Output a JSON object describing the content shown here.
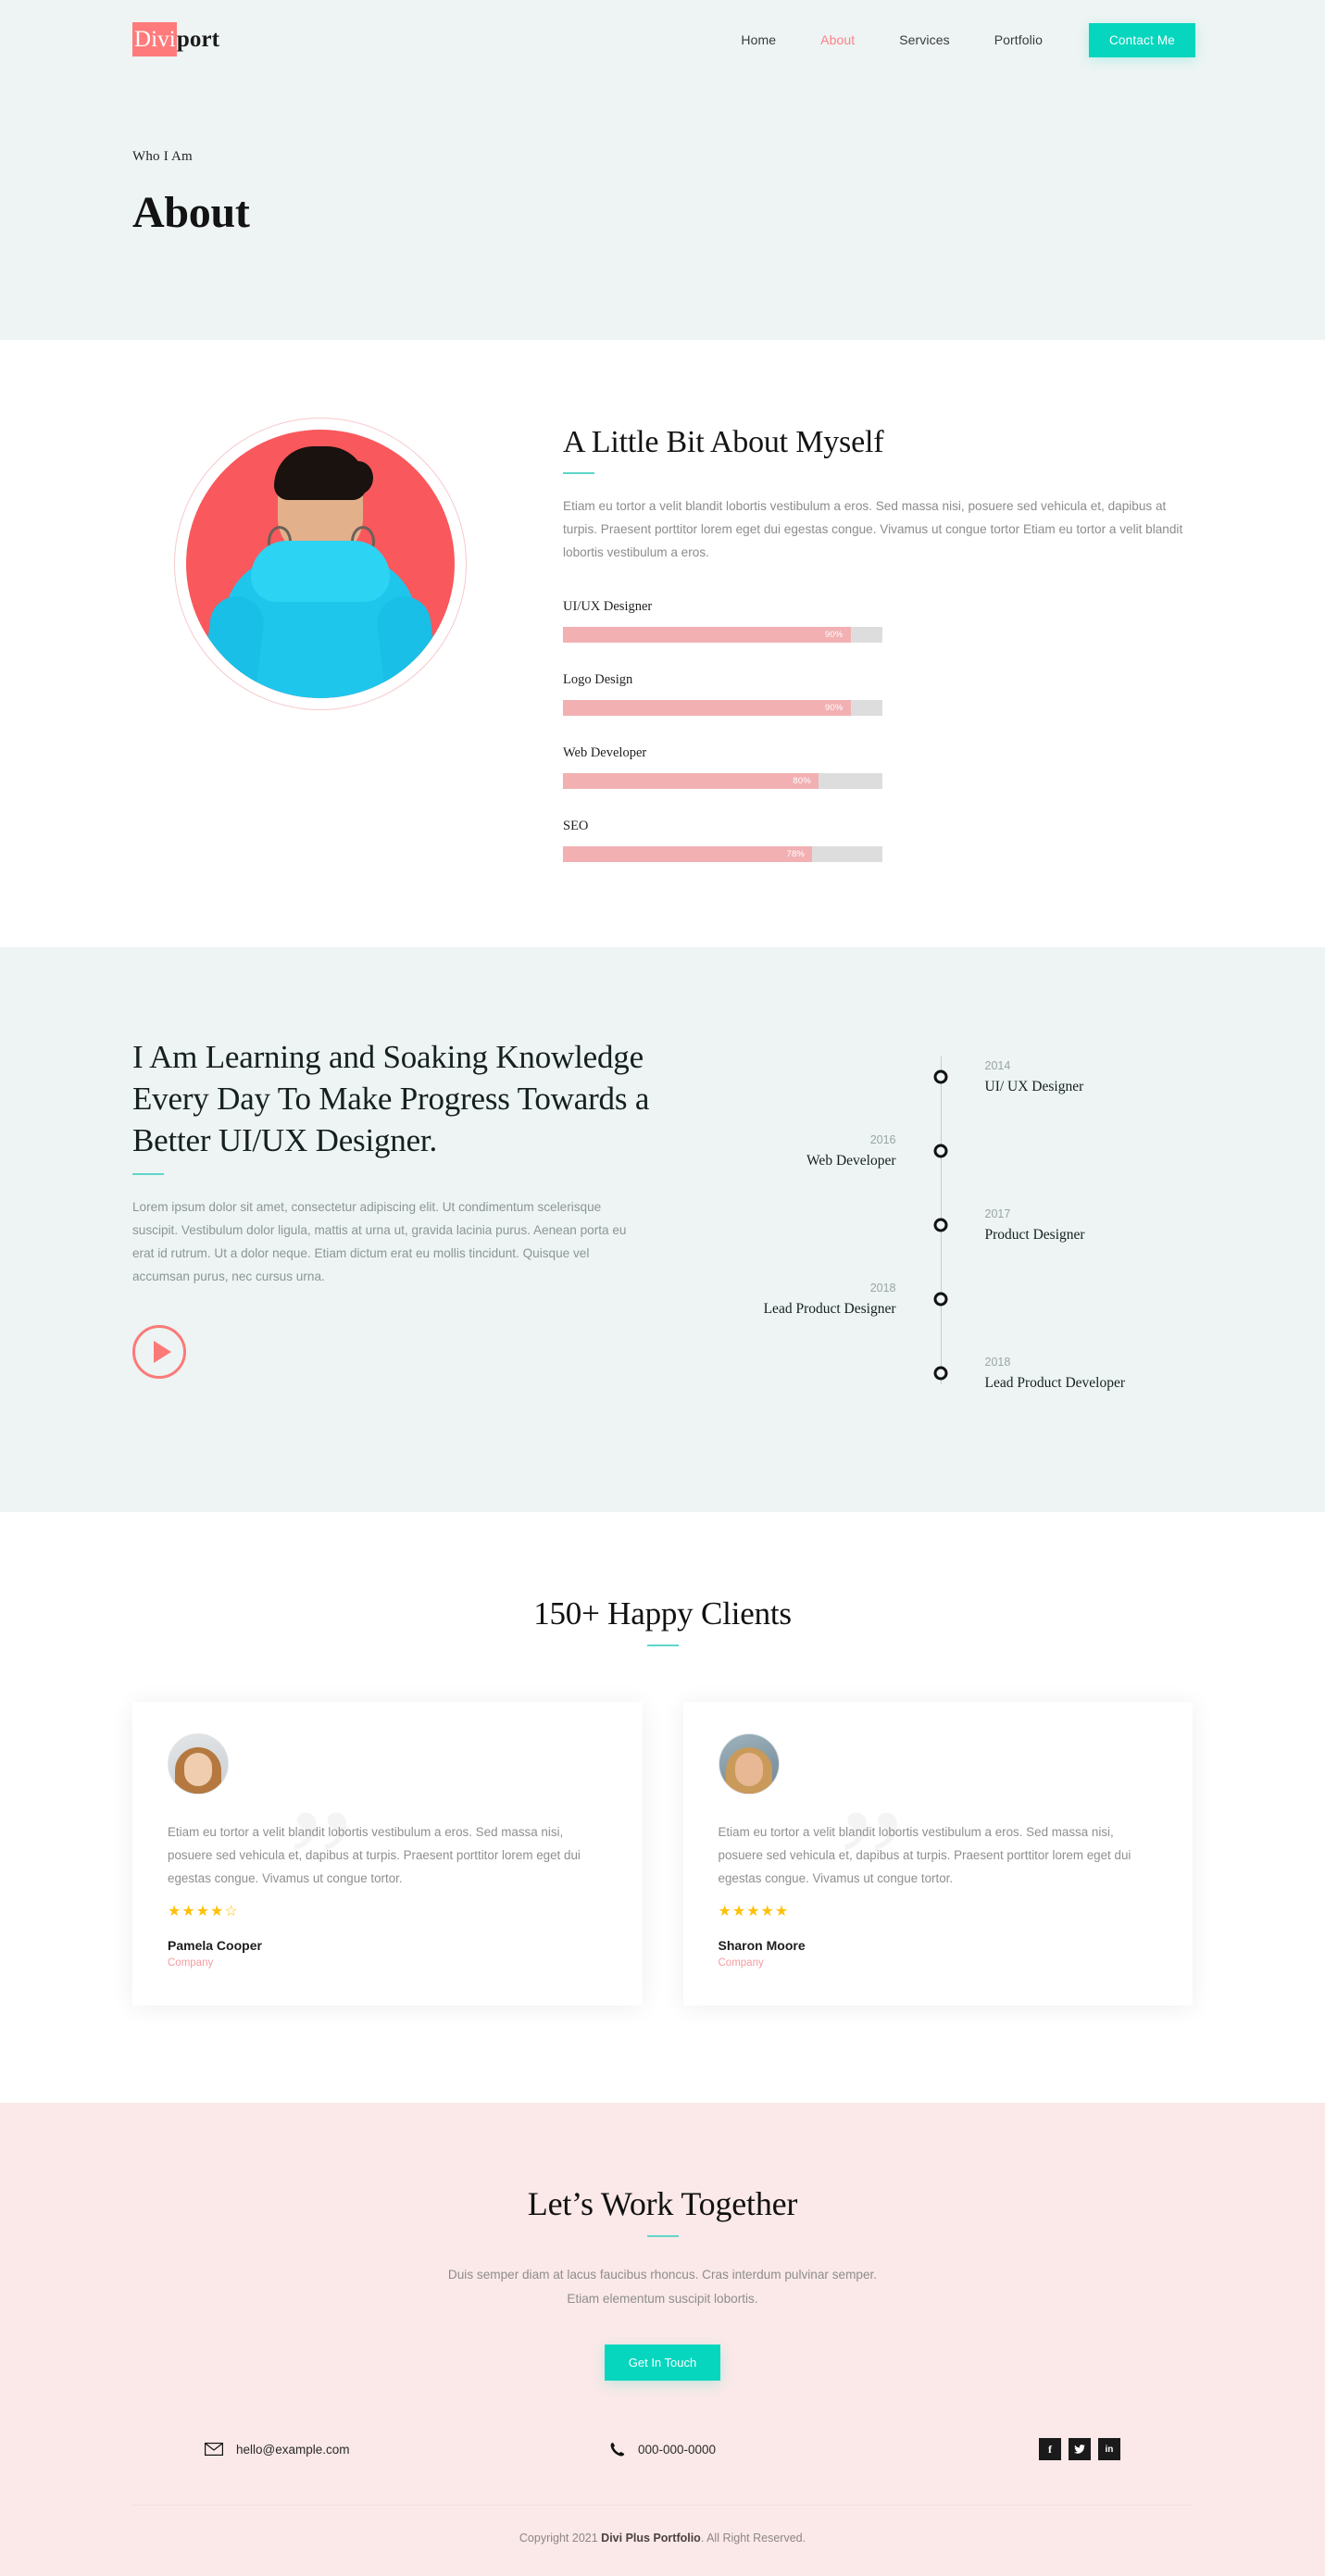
{
  "header": {
    "logo_mark": "Divi",
    "logo_rest": "port",
    "nav": [
      {
        "label": "Home",
        "active": false
      },
      {
        "label": "About",
        "active": true
      },
      {
        "label": "Services",
        "active": false
      },
      {
        "label": "Portfolio",
        "active": false
      }
    ],
    "contact_button": "Contact Me",
    "accent_color": "#06d6be",
    "background": "#edf4f3"
  },
  "hero": {
    "eyebrow": "Who I Am",
    "title": "About"
  },
  "about": {
    "heading": "A Little Bit About Myself",
    "paragraph": "Etiam eu tortor a velit blandit lobortis vestibulum a eros. Sed massa nisi, posuere sed vehicula et, dapibus at turpis. Praesent porttitor lorem eget dui egestas congue. Vivamus ut congue tortor Etiam eu tortor a velit blandit lobortis vestibulum a eros.",
    "photo_alt": "portrait-photo",
    "skills": [
      {
        "name": "UI/UX Designer",
        "percent": 90,
        "label": "90%"
      },
      {
        "name": "Logo Design",
        "percent": 90,
        "label": "90%"
      },
      {
        "name": "Web Developer",
        "percent": 80,
        "label": "80%"
      },
      {
        "name": "SEO",
        "percent": 78,
        "label": "78%"
      }
    ],
    "bar_fill_color": "#f2b0b3",
    "bar_track_color": "#dddddd"
  },
  "journey": {
    "heading": "I Am Learning and Soaking Knowledge Every Day To Make Progress Towards a Better UI/UX Designer.",
    "paragraph": "Lorem ipsum dolor sit amet, consectetur adipiscing elit. Ut condimentum scelerisque suscipit. Vestibulum dolor ligula, mattis at urna ut, gravida lacinia purus. Aenean porta eu erat id rutrum. Ut a dolor neque. Etiam dictum erat eu mollis tincidunt. Quisque vel accumsan purus, nec cursus urna.",
    "play_button_label": "play-video",
    "timeline": [
      {
        "year": "2014",
        "role": "UI/ UX Designer",
        "side": "right"
      },
      {
        "year": "2016",
        "role": "Web Developer",
        "side": "left"
      },
      {
        "year": "2017",
        "role": "Product Designer",
        "side": "right"
      },
      {
        "year": "2018",
        "role": "Lead Product Designer",
        "side": "left"
      },
      {
        "year": "2018",
        "role": "Lead Product Developer",
        "side": "right"
      }
    ]
  },
  "testimonials": {
    "heading": "150+ Happy Clients",
    "items": [
      {
        "text": "Etiam eu tortor a velit blandit lobortis vestibulum a eros. Sed massa nisi, posuere sed vehicula et, dapibus at turpis. Praesent porttitor lorem eget dui egestas congue. Vivamus ut congue tortor.",
        "stars": "★★★★☆",
        "rating": 4,
        "name": "Pamela Cooper",
        "company": "Company"
      },
      {
        "text": "Etiam eu tortor a velit blandit lobortis vestibulum a eros. Sed massa nisi, posuere sed vehicula et, dapibus at turpis. Praesent porttitor lorem eget dui egestas congue. Vivamus ut congue tortor.",
        "stars": "★★★★★",
        "rating": 5,
        "name": "Sharon Moore",
        "company": "Company"
      }
    ]
  },
  "cta": {
    "heading": "Let’s Work Together",
    "paragraph_line1": "Duis semper diam at lacus faucibus rhoncus. Cras interdum pulvinar semper.",
    "paragraph_line2": "Etiam elementum suscipit lobortis.",
    "button": "Get In Touch",
    "background": "#fae9e8"
  },
  "footer": {
    "email": "hello@example.com",
    "phone": "000-000-0000",
    "socials": [
      {
        "name": "facebook",
        "glyph": "f"
      },
      {
        "name": "twitter",
        "glyph": "ᵗ"
      },
      {
        "name": "linkedin",
        "glyph": "in"
      }
    ],
    "copyright_pre": "Copyright 2021 ",
    "copyright_brand": "Divi Plus Portfolio",
    "copyright_post": ". All Right Reserved."
  }
}
